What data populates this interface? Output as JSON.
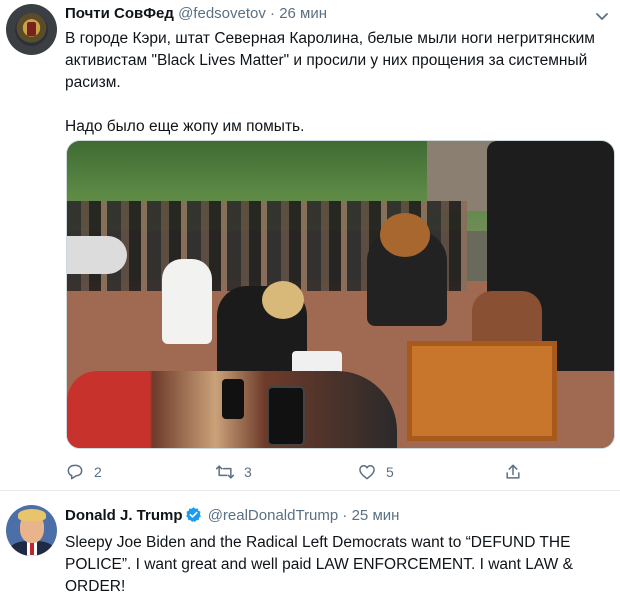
{
  "colors": {
    "text": "#0f1419",
    "secondary": "#5b7083",
    "verified": "#1d9bf0",
    "divider": "#e6ecf0"
  },
  "tweets": [
    {
      "author_name": "Почти СовФед",
      "author_handle": "@fedsovetov",
      "separator": "·",
      "time": "26 мин",
      "verified": false,
      "paragraphs": [
        "В городе Кэри, штат Северная Каролина, белые мыли ноги негритянским активистам \"Black Lives Matter\" и просили у них прощения за системный расизм.",
        "Надо было еще жопу им помыть."
      ],
      "has_photo": true,
      "reply_count": "2",
      "retweet_count": "3",
      "like_count": "5",
      "icons": [
        "chevron-down-icon",
        "reply-icon",
        "retweet-icon",
        "like-icon",
        "share-icon"
      ]
    },
    {
      "author_name": "Donald J. Trump",
      "author_handle": "@realDonaldTrump",
      "separator": "·",
      "time": "25 мин",
      "verified": true,
      "paragraphs": [
        "Sleepy Joe Biden and the Radical Left Democrats want to “DEFUND THE POLICE”. I want great and well paid LAW ENFORCEMENT. I want LAW & ORDER!"
      ],
      "has_photo": false,
      "icons": [
        "verified-badge-icon"
      ]
    }
  ]
}
